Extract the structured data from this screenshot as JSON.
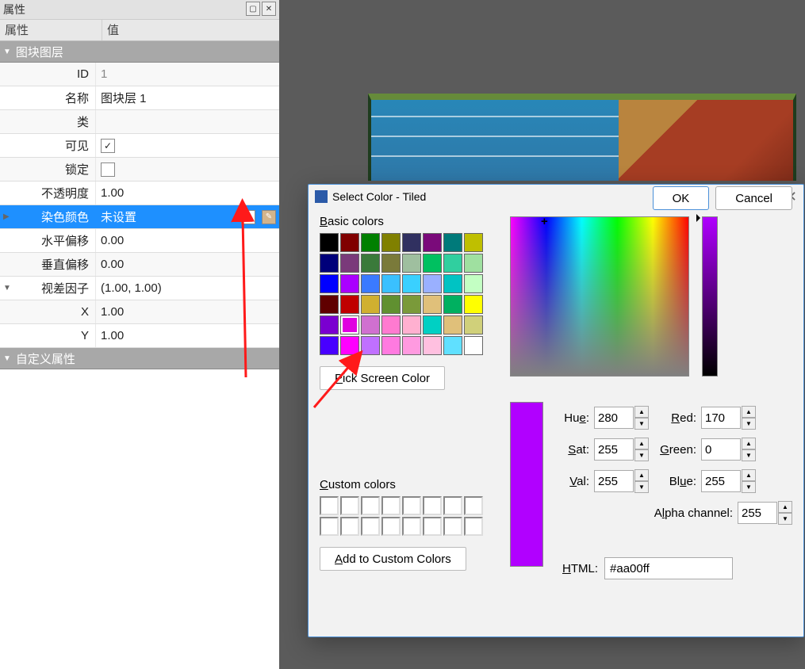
{
  "panel": {
    "title": "属性",
    "header_prop": "属性",
    "header_val": "值",
    "section1": "图块图层",
    "rows": {
      "id_label": "ID",
      "id_value": "1",
      "name_label": "名称",
      "name_value": "图块层 1",
      "class_label": "类",
      "class_value": "",
      "visible_label": "可见",
      "locked_label": "锁定",
      "opacity_label": "不透明度",
      "opacity_value": "1.00",
      "tint_label": "染色颜色",
      "tint_value": "未设置",
      "hoff_label": "水平偏移",
      "hoff_value": "0.00",
      "voff_label": "垂直偏移",
      "voff_value": "0.00",
      "parallax_label": "视差因子",
      "parallax_value": "(1.00, 1.00)",
      "x_label": "X",
      "x_value": "1.00",
      "y_label": "Y",
      "y_value": "1.00"
    },
    "section2": "自定义属性"
  },
  "dialog": {
    "title": "Select Color - Tiled",
    "basic_label": "Basic colors",
    "pick_btn": "Pick Screen Color",
    "custom_label": "Custom colors",
    "add_btn": "Add to Custom Colors",
    "labels": {
      "hue": "Hue:",
      "sat": "Sat:",
      "val": "Val:",
      "red": "Red:",
      "green": "Green:",
      "blue": "Blue:",
      "alpha": "Alpha channel:",
      "html": "HTML:"
    },
    "values": {
      "hue": "280",
      "sat": "255",
      "val": "255",
      "red": "170",
      "green": "0",
      "blue": "255",
      "alpha": "255",
      "html": "#aa00ff"
    },
    "ok": "OK",
    "cancel": "Cancel"
  },
  "basic_swatches": [
    "#000000",
    "#800000",
    "#008000",
    "#808000",
    "#303060",
    "#7a0a7a",
    "#007a7a",
    "#bfbf00",
    "#00007a",
    "#7a3a7a",
    "#3a7a3a",
    "#7a7a3a",
    "#9fbf9f",
    "#00c060",
    "#30cf9f",
    "#9fe0a0",
    "#0000ff",
    "#aa00ff",
    "#3a7aff",
    "#3ac0ff",
    "#3ad0ff",
    "#9ab0ff",
    "#00c3c3",
    "#c3ffc3",
    "#600000",
    "#c00000",
    "#d0b030",
    "#609030",
    "#7a9a3a",
    "#e0c07a",
    "#00b060",
    "#ffff00",
    "#7a00d0",
    "#e000e0",
    "#d070d0",
    "#ff7ad0",
    "#ffb0d0",
    "#00d0c3",
    "#e0c07a",
    "#d0d07a",
    "#4800ff",
    "#ff00ff",
    "#c070ff",
    "#ff7ae0",
    "#ff9ae0",
    "#ffc0e0",
    "#60e0ff",
    "#ffffff"
  ]
}
